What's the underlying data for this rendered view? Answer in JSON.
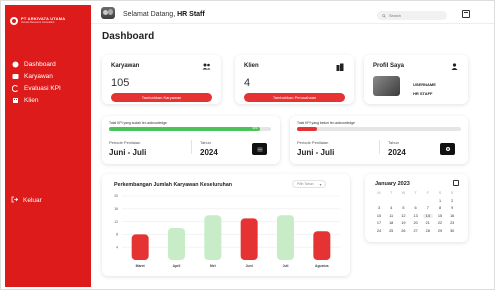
{
  "sidebar": {
    "brand_name": "PT ARKIVATA UTAMA",
    "brand_sub": "Human Resource Consultant",
    "items": [
      {
        "label": "Dashboard",
        "icon": "dashboard-icon"
      },
      {
        "label": "Karyawan",
        "icon": "employee-icon"
      },
      {
        "label": "Evaluasi KPI",
        "icon": "evaluation-icon"
      },
      {
        "label": "Klien",
        "icon": "client-icon"
      }
    ],
    "logout_label": "Keluar"
  },
  "topbar": {
    "greeting": "Selamat Datang,",
    "user": "HR Staff",
    "search_placeholder": "Search"
  },
  "page_title": "Dashboard",
  "cards": {
    "karyawan": {
      "label": "Karyawan",
      "value": "105",
      "button": "Tambahkan Karyawan"
    },
    "klien": {
      "label": "Klien",
      "value": "4",
      "button": "Tambahkan Perusahaan"
    },
    "profil": {
      "label": "Profil Saya",
      "username": "USERNAME",
      "role": "HR STAFF"
    }
  },
  "kpi": [
    {
      "label": "Total KPI yang sudah ter-acknowledge",
      "progress": 0.93,
      "pct": "93%",
      "color": "#4cc25a",
      "period_label": "Periode Penilaian",
      "period_value": "Juni - Juli",
      "year_label": "Tahun",
      "year_value": "2024"
    },
    {
      "label": "Total KPI yang belum ter-acknowledge",
      "progress": 0.12,
      "pct": "",
      "color": "#e53333",
      "period_label": "Periode Penilaian",
      "period_value": "Juni - Juli",
      "year_label": "Tahun",
      "year_value": "2024"
    }
  ],
  "chart": {
    "filter": "Pilih Tahun",
    "chart_data": {
      "type": "bar",
      "title": "Perkembangan Jumlah Karyawan Keseluruhan",
      "categories": [
        "Maret",
        "April",
        "Mei",
        "Juni",
        "Juli",
        "Agustus"
      ],
      "values": [
        8,
        10,
        14,
        13,
        14,
        9
      ],
      "colors": [
        "#e53333",
        "#c8ecc8",
        "#c8ecc8",
        "#e53333",
        "#c8ecc8",
        "#e53333"
      ],
      "yticks": [
        "4",
        "8",
        "12",
        "16",
        "20"
      ],
      "ylim": [
        0,
        20
      ],
      "xlabel": "",
      "ylabel": ""
    }
  },
  "calendar": {
    "title": "January 2023",
    "days": [
      "M",
      "T",
      "W",
      "T",
      "F",
      "S",
      "S"
    ],
    "weeks": [
      [
        "",
        "",
        "",
        "",
        "",
        "1",
        "2"
      ],
      [
        "3",
        "4",
        "5",
        "6",
        "7",
        "8",
        "9"
      ],
      [
        "10",
        "11",
        "12",
        "13",
        "14",
        "15",
        "16"
      ],
      [
        "17",
        "18",
        "19",
        "20",
        "21",
        "22",
        "23"
      ],
      [
        "24",
        "25",
        "26",
        "27",
        "28",
        "29",
        "30"
      ]
    ],
    "selected": "14"
  }
}
